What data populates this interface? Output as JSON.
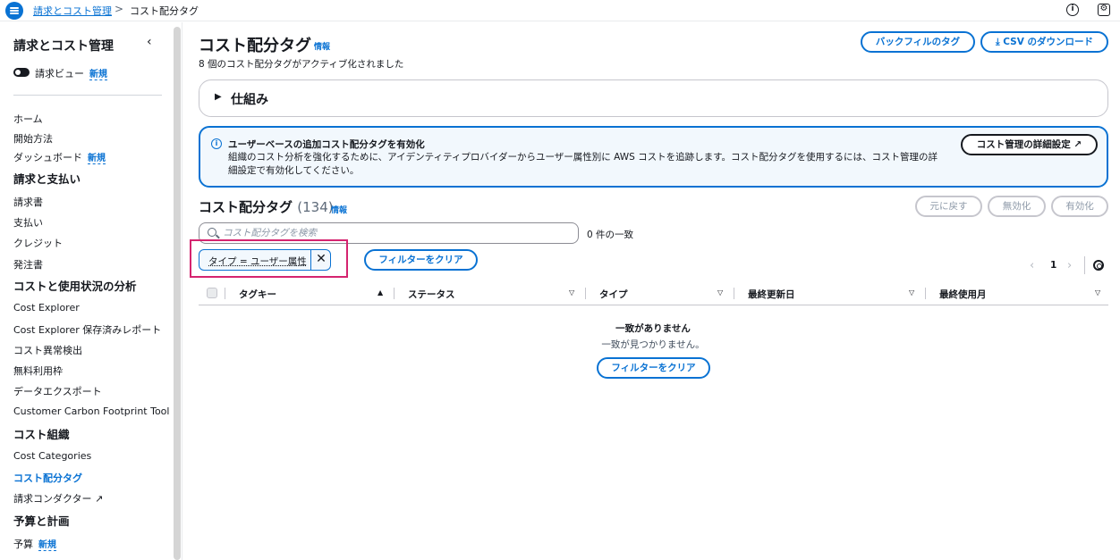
{
  "topbar": {
    "breadcrumb_parent": "請求とコスト管理",
    "breadcrumb_separator": ">",
    "breadcrumb_current": "コスト配分タグ",
    "info_icon": "i",
    "settings_icon": "⚙"
  },
  "sidebar": {
    "title": "請求とコスト管理",
    "collapse_icon": "‹",
    "billing_view_label": "請求ビュー",
    "new_badge": "新規",
    "items_top": [
      "ホーム",
      "開始方法",
      "ダッシュボード"
    ],
    "section_billing": "請求と支払い",
    "items_billing": [
      "請求書",
      "支払い",
      "クレジット",
      "発注書"
    ],
    "section_analysis": "コストと使用状況の分析",
    "items_analysis": [
      "Cost Explorer",
      "Cost Explorer 保存済みレポート",
      "コスト異常検出",
      "無料利用枠",
      "データエクスポート",
      "Customer Carbon Footprint Tool"
    ],
    "section_org": "コスト組織",
    "items_org": [
      "Cost Categories",
      "コスト配分タグ",
      "請求コンダクター"
    ],
    "external_icon": "↗",
    "section_budget": "予算と計画",
    "items_budget": [
      "予算"
    ]
  },
  "main": {
    "title": "コスト配分タグ",
    "info": "情報",
    "subtitle": "8 個のコスト配分タグがアクティブ化されました",
    "backfill_button": "バックフィルのタグ",
    "download_button": "CSV のダウンロード",
    "download_icon": "⤓",
    "expander_caret": "▶",
    "expander_title": "仕組み",
    "alert": {
      "icon": "i",
      "title": "ユーザーベースの追加コスト配分タグを有効化",
      "body": "組織のコスト分析を強化するために、アイデンティティプロバイダーからユーザー属性別に AWS コストを追跡します。コスト配分タグを使用するには、コスト管理の詳細設定で有効化してください。",
      "button": "コスト管理の詳細設定",
      "button_icon": "↗"
    },
    "section_title": "コスト配分タグ",
    "section_count": "(134)",
    "revert_button": "元に戻す",
    "disable_button": "無効化",
    "enable_button": "有効化",
    "search_placeholder": "コスト配分タグを検索",
    "match_count": "0 件の一致",
    "filter_token": "タイプ = ユーザー属性",
    "filter_token_close": "✕",
    "clear_filter_button": "フィルターをクリア",
    "pager_prev": "‹",
    "pager_page": "1",
    "pager_next": "›",
    "columns": [
      {
        "label": "タグキー",
        "sort": "▲"
      },
      {
        "label": "ステータス",
        "sort": "▽"
      },
      {
        "label": "タイプ",
        "sort": "▽"
      },
      {
        "label": "最終更新日",
        "sort": "▽"
      },
      {
        "label": "最終使用月",
        "sort": "▽"
      }
    ],
    "empty_title": "一致がありません",
    "empty_subtitle": "一致が見つかりません。"
  }
}
